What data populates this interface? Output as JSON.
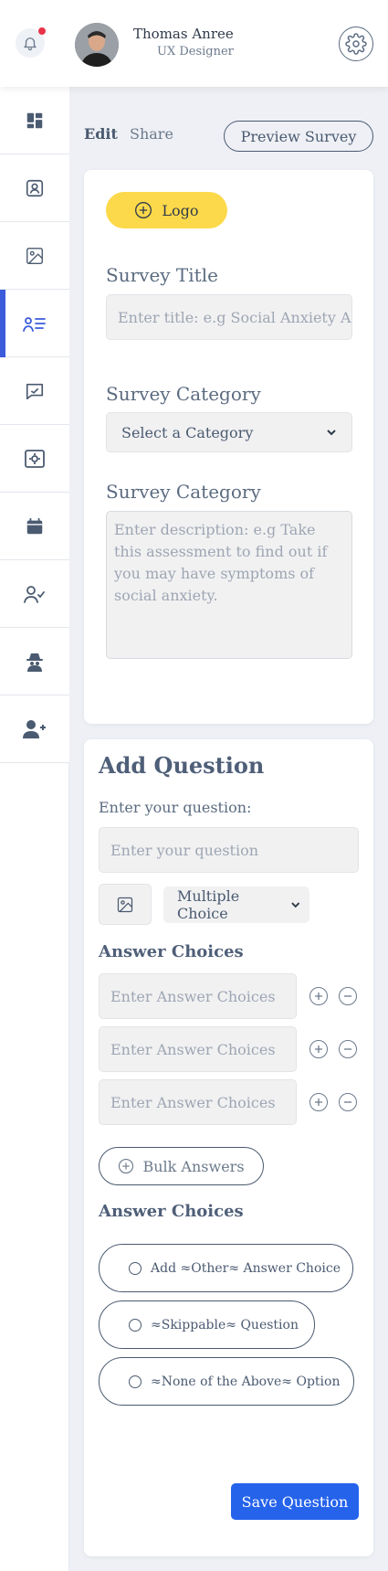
{
  "header": {
    "user_name": "Thomas Anree",
    "user_role": "UX Designer",
    "notification_dot_color": "#e8334a"
  },
  "sidebar": {
    "items": [
      {
        "icon": "dashboard-icon",
        "active": false
      },
      {
        "icon": "profile-icon",
        "active": false
      },
      {
        "icon": "image-icon",
        "active": false
      },
      {
        "icon": "survey-list-icon",
        "active": true
      },
      {
        "icon": "chat-icon",
        "active": false
      },
      {
        "icon": "settings-screen-icon",
        "active": false
      },
      {
        "icon": "calendar-icon",
        "active": false
      },
      {
        "icon": "user-check-icon",
        "active": false
      },
      {
        "icon": "spy-icon",
        "active": false
      },
      {
        "icon": "add-user-icon",
        "active": false
      }
    ],
    "active_color": "#3b5bdb"
  },
  "tabs": {
    "edit": "Edit",
    "share": "Share",
    "preview": "Preview Survey"
  },
  "survey": {
    "logo_label": "Logo",
    "title_label": "Survey Title",
    "title_placeholder": "Enter title: e.g Social Anxiety Assessment",
    "category_label": "Survey Category",
    "category_selected": "Select a Category",
    "description_label": "Survey Category",
    "description_placeholder": "Enter description: e.g Take this assessment to find out if you may have symptoms of social anxiety."
  },
  "question": {
    "title": "Add Question",
    "prompt": "Enter your question:",
    "placeholder": "Enter your question",
    "type_selected": "Multiple Choice",
    "answers_heading": "Answer Choices",
    "answer_placeholders": [
      "Enter Answer Choices",
      "Enter Answer Choices",
      "Enter Answer Choices"
    ],
    "bulk_label": "Bulk Answers",
    "options_heading": "Answer Choices",
    "options": [
      "Add ≈Other≈ Answer Choice",
      "≈Skippable≈ Question",
      "≈None of the Above≈ Option"
    ],
    "save_label": "Save Question"
  },
  "colors": {
    "primary": "#2563eb",
    "logo_bg": "#fcd94a",
    "page_bg": "#eef0f5"
  }
}
